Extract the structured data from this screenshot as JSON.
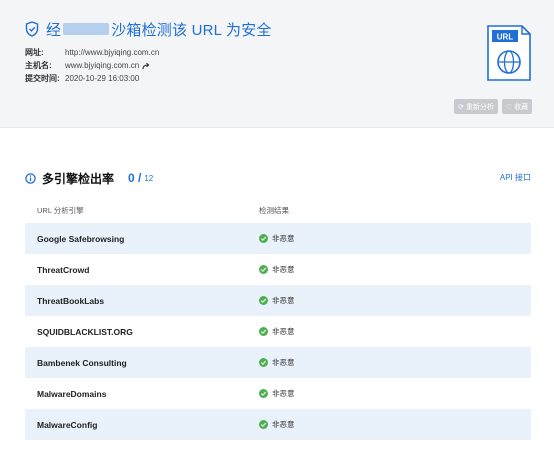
{
  "header": {
    "title_prefix": "经",
    "title_suffix": "沙箱检测该 URL 为安全",
    "meta": [
      {
        "label": "网址:",
        "value": "http://www.bjyiqing.com.cn"
      },
      {
        "label": "主机名:",
        "value": "www.bjyiqing.com.cn"
      },
      {
        "label": "提交时间:",
        "value": "2020-10-29 16:03:00"
      }
    ],
    "doc_icon_label": "URL",
    "buttons": {
      "reanalyze": "重新分析",
      "favorite": "收藏"
    }
  },
  "section": {
    "title": "多引擎检出率",
    "count": "0 /",
    "total": "12",
    "api_link": "API 接口",
    "columns": {
      "engine": "URL 分析引擎",
      "result": "检测结果"
    },
    "rows": [
      {
        "engine": "Google Safebrowsing",
        "result": "非恶意"
      },
      {
        "engine": "ThreatCrowd",
        "result": "非恶意"
      },
      {
        "engine": "ThreatBookLabs",
        "result": "非恶意"
      },
      {
        "engine": "SQUIDBLACKLIST.ORG",
        "result": "非恶意"
      },
      {
        "engine": "Bambenek Consulting",
        "result": "非恶意"
      },
      {
        "engine": "MalwareDomains",
        "result": "非恶意"
      },
      {
        "engine": "MalwareConfig",
        "result": "非恶意"
      }
    ]
  },
  "colors": {
    "accent": "#1f6fd6",
    "safe": "#4bb04f",
    "row_alt": "#e9f1fb"
  }
}
